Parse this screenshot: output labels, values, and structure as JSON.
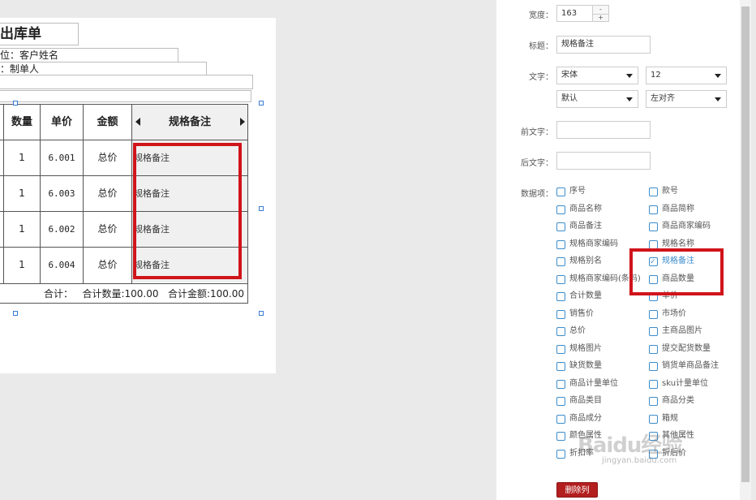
{
  "document": {
    "title": "出库单",
    "unit_field": "位：客户姓名",
    "maker_field": "：制单人"
  },
  "table": {
    "headers": [
      "数量",
      "单价",
      "金额",
      "规格备注"
    ],
    "rows": [
      {
        "qty": "1",
        "price": "6.001",
        "amount": "总价",
        "spec": "规格备注"
      },
      {
        "qty": "1",
        "price": "6.003",
        "amount": "总价",
        "spec": "规格备注"
      },
      {
        "qty": "1",
        "price": "6.002",
        "amount": "总价",
        "spec": "规格备注"
      },
      {
        "qty": "1",
        "price": "6.004",
        "amount": "总价",
        "spec": "规格备注"
      }
    ],
    "total_label": "合计：",
    "total_qty": "合计数量:100.00",
    "total_amount": "合计金额:100.00"
  },
  "panel": {
    "width_label": "宽度：",
    "width_value": "163",
    "spin_up": "-",
    "spin_down": "+",
    "title_label": "标题：",
    "title_value": "规格备注",
    "text_label": "文字：",
    "font_value": "宋体",
    "size_value": "12",
    "style_value": "默认",
    "align_value": "左对齐",
    "prefix_label": "前文字：",
    "suffix_label": "后文字：",
    "items_label": "数据项：",
    "items_left": [
      {
        "label": "序号",
        "checked": false
      },
      {
        "label": "商品名称",
        "checked": false
      },
      {
        "label": "商品备注",
        "checked": false
      },
      {
        "label": "规格商家编码",
        "checked": false
      },
      {
        "label": "规格别名",
        "checked": false
      },
      {
        "label": "规格商家编码(条码)",
        "checked": false
      },
      {
        "label": "合计数量",
        "checked": false
      },
      {
        "label": "销售价",
        "checked": false
      },
      {
        "label": "总价",
        "checked": false
      },
      {
        "label": "规格图片",
        "checked": false
      },
      {
        "label": "缺货数量",
        "checked": false
      },
      {
        "label": "商品计量单位",
        "checked": false
      },
      {
        "label": "商品类目",
        "checked": false
      },
      {
        "label": "商品成分",
        "checked": false
      },
      {
        "label": "颜色属性",
        "checked": false
      },
      {
        "label": "折扣率",
        "checked": false
      }
    ],
    "items_right": [
      {
        "label": "款号",
        "checked": false
      },
      {
        "label": "商品简称",
        "checked": false
      },
      {
        "label": "商品商家编码",
        "checked": false
      },
      {
        "label": "规格名称",
        "checked": false
      },
      {
        "label": "规格备注",
        "checked": true
      },
      {
        "label": "商品数量",
        "checked": false
      },
      {
        "label": "单价",
        "checked": false
      },
      {
        "label": "市场价",
        "checked": false
      },
      {
        "label": "主商品图片",
        "checked": false
      },
      {
        "label": "提交配货数量",
        "checked": false
      },
      {
        "label": "销货单商品备注",
        "checked": false
      },
      {
        "label": "sku计量单位",
        "checked": false
      },
      {
        "label": "商品分类",
        "checked": false
      },
      {
        "label": "箱规",
        "checked": false
      },
      {
        "label": "其他属性",
        "checked": false
      },
      {
        "label": "折后价",
        "checked": false
      }
    ],
    "delete_label": "删除列"
  },
  "watermark": {
    "main": "Baidu经验",
    "sub": "jingyan.baidu.com"
  },
  "colors": {
    "highlight_red": "#d0141b",
    "checkbox_blue": "#3c8dcc",
    "delete_button": "#b31e1e"
  }
}
